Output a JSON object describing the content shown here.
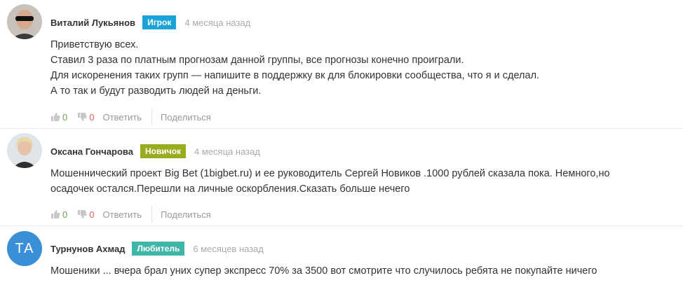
{
  "comments": [
    {
      "author": "Виталий Лукьянов",
      "badge": "Игрок",
      "badge_color": "#1aa3d9",
      "time": "4 месяца назад",
      "lines": [
        "Приветствую всех.",
        "Ставил 3 раза по платным прогнозам данной группы, все прогнозы конечно проиграли.",
        "Для искоренения таких групп — напишите в поддержку вк для блокировки сообщества, что я и сделал.",
        "А то так и будут разводить людей на деньги."
      ],
      "likes": "0",
      "dislikes": "0",
      "reply": "Ответить",
      "share": "Поделиться"
    },
    {
      "author": "Оксана Гончарова",
      "badge": "Новичок",
      "badge_color": "#9bab1f",
      "time": "4 месяца назад",
      "lines": [
        "Мошеннический проект Big Bet (1bigbet.ru) и ее руководитель Сергей Новиков .1000 рублей сказала пока. Немного,но",
        "осадочек остался.Перешли на личные оскорбления.Сказать больше нечего"
      ],
      "likes": "0",
      "dislikes": "0",
      "reply": "Ответить",
      "share": "Поделиться"
    },
    {
      "author": "Турнунов Ахмад",
      "badge": "Любитель",
      "badge_color": "#3fb6a8",
      "time": "6 месяцев назад",
      "avatar_initials": "ТА",
      "lines": [
        "Мошеники ... вчера брал уних супер экспресс 70% за 3500 вот смотрите что случилось ребята не покупайте ничего"
      ]
    }
  ]
}
